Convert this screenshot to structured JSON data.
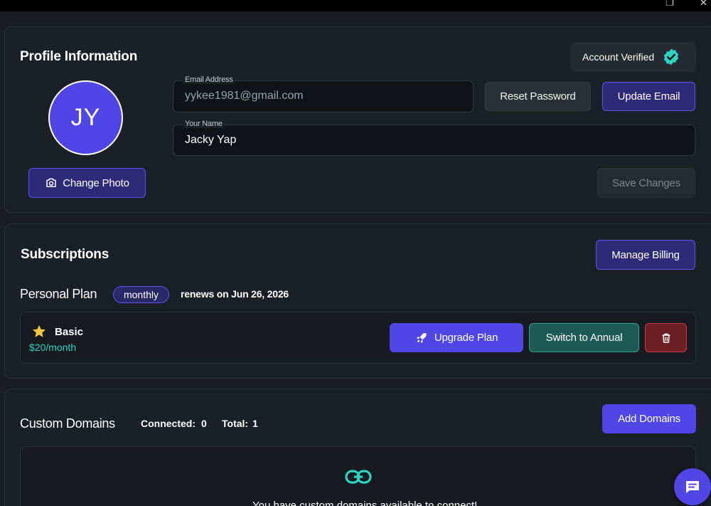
{
  "window": {
    "restore_glyph": "❐",
    "close_glyph": "✕"
  },
  "profile": {
    "title": "Profile Information",
    "avatar_initials": "JY",
    "change_photo_label": "Change Photo",
    "verified_label": "Account Verified",
    "email": {
      "label": "Email Address",
      "value": "yykee1981@gmail.com"
    },
    "name": {
      "label": "Your Name",
      "value": "Jacky Yap"
    },
    "reset_password_label": "Reset Password",
    "update_email_label": "Update Email",
    "save_changes_label": "Save Changes"
  },
  "subscriptions": {
    "title": "Subscriptions",
    "manage_billing_label": "Manage Billing",
    "plan_name": "Personal Plan",
    "cycle_badge": "monthly",
    "renewal_text": "renews on Jun 26, 2026",
    "tier": {
      "name": "Basic",
      "price": "$20/month",
      "icon": "star-icon"
    },
    "upgrade_label": "Upgrade Plan",
    "switch_label": "Switch to Annual",
    "delete_icon": "trash-icon"
  },
  "domains": {
    "title": "Custom Domains",
    "connected_label": "Connected:",
    "connected_value": "0",
    "total_label": "Total:",
    "total_value": "1",
    "add_label": "Add Domains",
    "empty_icon": "link-icon",
    "empty_text": "You have custom domains available to connect!"
  },
  "colors": {
    "accent": "#4f46e5",
    "teal": "#2fa393",
    "danger": "#cc3b40",
    "price": "#2dd4bf",
    "verified_badge": "#2dd4bf"
  }
}
